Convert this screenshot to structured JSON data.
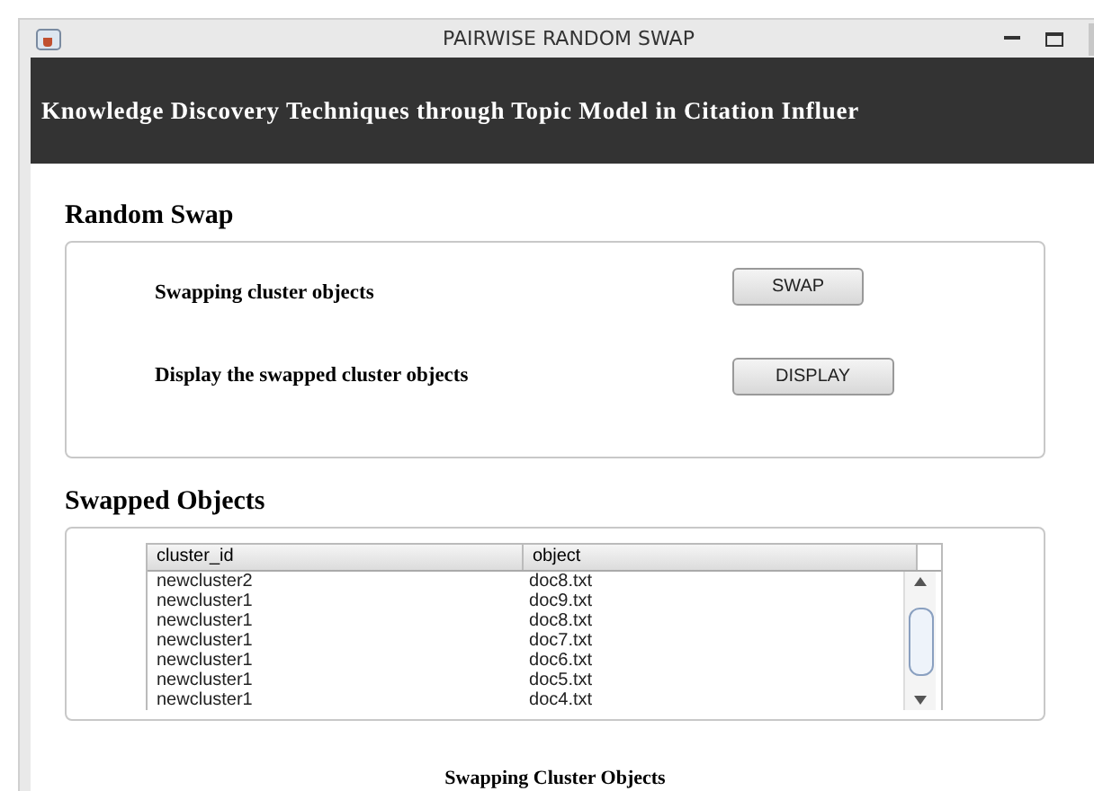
{
  "window": {
    "title": "PAIRWISE RANDOM SWAP"
  },
  "banner": "Knowledge Discovery Techniques through Topic Model in Citation Influer",
  "random_swap": {
    "heading": "Random Swap",
    "actions": [
      {
        "label": "Swapping cluster objects",
        "button": "SWAP"
      },
      {
        "label": "Display the swapped cluster objects",
        "button": "DISPLAY"
      }
    ]
  },
  "swapped_objects": {
    "heading": "Swapped Objects",
    "table": {
      "columns": [
        "cluster_id",
        "object"
      ],
      "rows": [
        [
          "newcluster2",
          "doc8.txt"
        ],
        [
          "newcluster1",
          "doc9.txt"
        ],
        [
          "newcluster1",
          "doc8.txt"
        ],
        [
          "newcluster1",
          "doc7.txt"
        ],
        [
          "newcluster1",
          "doc6.txt"
        ],
        [
          "newcluster1",
          "doc5.txt"
        ],
        [
          "newcluster1",
          "doc4.txt"
        ]
      ]
    }
  },
  "status": "Swapping Cluster Objects"
}
